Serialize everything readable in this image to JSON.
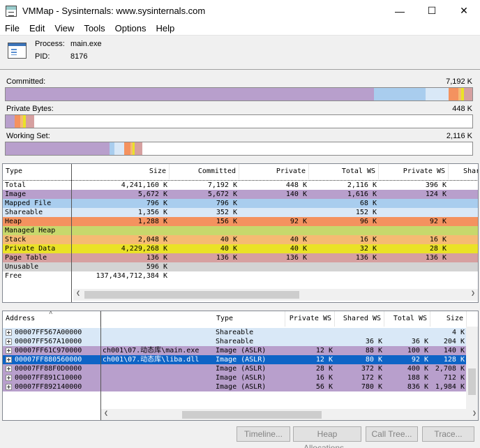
{
  "window": {
    "title": "VMMap - Sysinternals: www.sysinternals.com",
    "minimize": "—",
    "maximize": "☐",
    "close": "✕"
  },
  "menu": [
    "File",
    "Edit",
    "View",
    "Tools",
    "Options",
    "Help"
  ],
  "process": {
    "process_label": "Process:",
    "process_value": "main.exe",
    "pid_label": "PID:",
    "pid_value": "8176"
  },
  "bars": {
    "committed": {
      "label": "Committed:",
      "value": "7,192 K"
    },
    "private": {
      "label": "Private Bytes:",
      "value": "448 K"
    },
    "working": {
      "label": "Working Set:",
      "value": "2,116 K"
    }
  },
  "colors": {
    "image": "#b89fcc",
    "mapped": "#a9cdee",
    "shareable": "#d9e8f7",
    "heap": "#f4925f",
    "managed": "#c7d86c",
    "stack": "#f5bb73",
    "private": "#eae227",
    "pagetable": "#d6a0a0",
    "unusable": "#d3d3d3",
    "selected": "#0e64c6"
  },
  "summary": {
    "columns": [
      "Type",
      "Size",
      "Committed",
      "Private",
      "Total WS",
      "Private WS",
      "Shar"
    ],
    "rows": [
      {
        "type": "Total",
        "size": "4,241,160 K",
        "committed": "7,192 K",
        "private": "448 K",
        "total_ws": "2,116 K",
        "private_ws": "396 K",
        "color": "#ffffff"
      },
      {
        "type": "Image",
        "size": "5,672 K",
        "committed": "5,672 K",
        "private": "140 K",
        "total_ws": "1,616 K",
        "private_ws": "124 K",
        "color": "#b89fcc"
      },
      {
        "type": "Mapped File",
        "size": "796 K",
        "committed": "796 K",
        "private": "",
        "total_ws": "68 K",
        "private_ws": "",
        "color": "#a9cdee"
      },
      {
        "type": "Shareable",
        "size": "1,356 K",
        "committed": "352 K",
        "private": "",
        "total_ws": "152 K",
        "private_ws": "",
        "color": "#d9e8f7"
      },
      {
        "type": "Heap",
        "size": "1,288 K",
        "committed": "156 K",
        "private": "92 K",
        "total_ws": "96 K",
        "private_ws": "92 K",
        "color": "#f4925f"
      },
      {
        "type": "Managed Heap",
        "size": "",
        "committed": "",
        "private": "",
        "total_ws": "",
        "private_ws": "",
        "color": "#c7d86c"
      },
      {
        "type": "Stack",
        "size": "2,048 K",
        "committed": "40 K",
        "private": "40 K",
        "total_ws": "16 K",
        "private_ws": "16 K",
        "color": "#f5bb73"
      },
      {
        "type": "Private Data",
        "size": "4,229,268 K",
        "committed": "40 K",
        "private": "40 K",
        "total_ws": "32 K",
        "private_ws": "28 K",
        "color": "#eae227"
      },
      {
        "type": "Page Table",
        "size": "136 K",
        "committed": "136 K",
        "private": "136 K",
        "total_ws": "136 K",
        "private_ws": "136 K",
        "color": "#d6a0a0"
      },
      {
        "type": "Unusable",
        "size": "596 K",
        "committed": "",
        "private": "",
        "total_ws": "",
        "private_ws": "",
        "color": "#d3d3d3"
      },
      {
        "type": "Free",
        "size": "137,434,712,384 K",
        "committed": "",
        "private": "",
        "total_ws": "",
        "private_ws": "",
        "color": "#ffffff"
      }
    ]
  },
  "detail": {
    "columns": [
      "Address",
      "Type",
      "Private WS",
      "Shared WS",
      "Total WS",
      "Size"
    ],
    "rows": [
      {
        "address": "00007FF567A00000",
        "detail": "",
        "type": "Shareable",
        "private_ws": "",
        "shared_ws": "",
        "total_ws": "",
        "size": "4 K",
        "color": "#d9e8f7"
      },
      {
        "address": "00007FF567A10000",
        "detail": "",
        "type": "Shareable",
        "private_ws": "",
        "shared_ws": "36 K",
        "total_ws": "36 K",
        "size": "204 K",
        "color": "#d9e8f7"
      },
      {
        "address": "00007FF61C970000",
        "detail": "ch001\\07.动态库\\main.exe",
        "type": "Image (ASLR)",
        "private_ws": "12 K",
        "shared_ws": "88 K",
        "total_ws": "100 K",
        "size": "140 K",
        "color": "#b89fcc"
      },
      {
        "address": "00007FF880560000",
        "detail": "ch001\\07.动态库\\liba.dll",
        "type": "Image (ASLR)",
        "private_ws": "12 K",
        "shared_ws": "80 K",
        "total_ws": "92 K",
        "size": "128 K",
        "color": "#0e64c6",
        "selected": true
      },
      {
        "address": "00007FF88F0D0000",
        "detail": "",
        "type": "Image (ASLR)",
        "private_ws": "28 K",
        "shared_ws": "372 K",
        "total_ws": "400 K",
        "size": "2,708 K",
        "color": "#b89fcc"
      },
      {
        "address": "00007FF891C10000",
        "detail": "",
        "type": "Image (ASLR)",
        "private_ws": "16 K",
        "shared_ws": "172 K",
        "total_ws": "188 K",
        "size": "712 K",
        "color": "#b89fcc"
      },
      {
        "address": "00007FF892140000",
        "detail": "",
        "type": "Image (ASLR)",
        "private_ws": "56 K",
        "shared_ws": "780 K",
        "total_ws": "836 K",
        "size": "1,984 K",
        "color": "#b89fcc"
      }
    ]
  },
  "buttons": [
    "Timeline...",
    "Heap Allocations...",
    "Call Tree...",
    "Trace..."
  ]
}
